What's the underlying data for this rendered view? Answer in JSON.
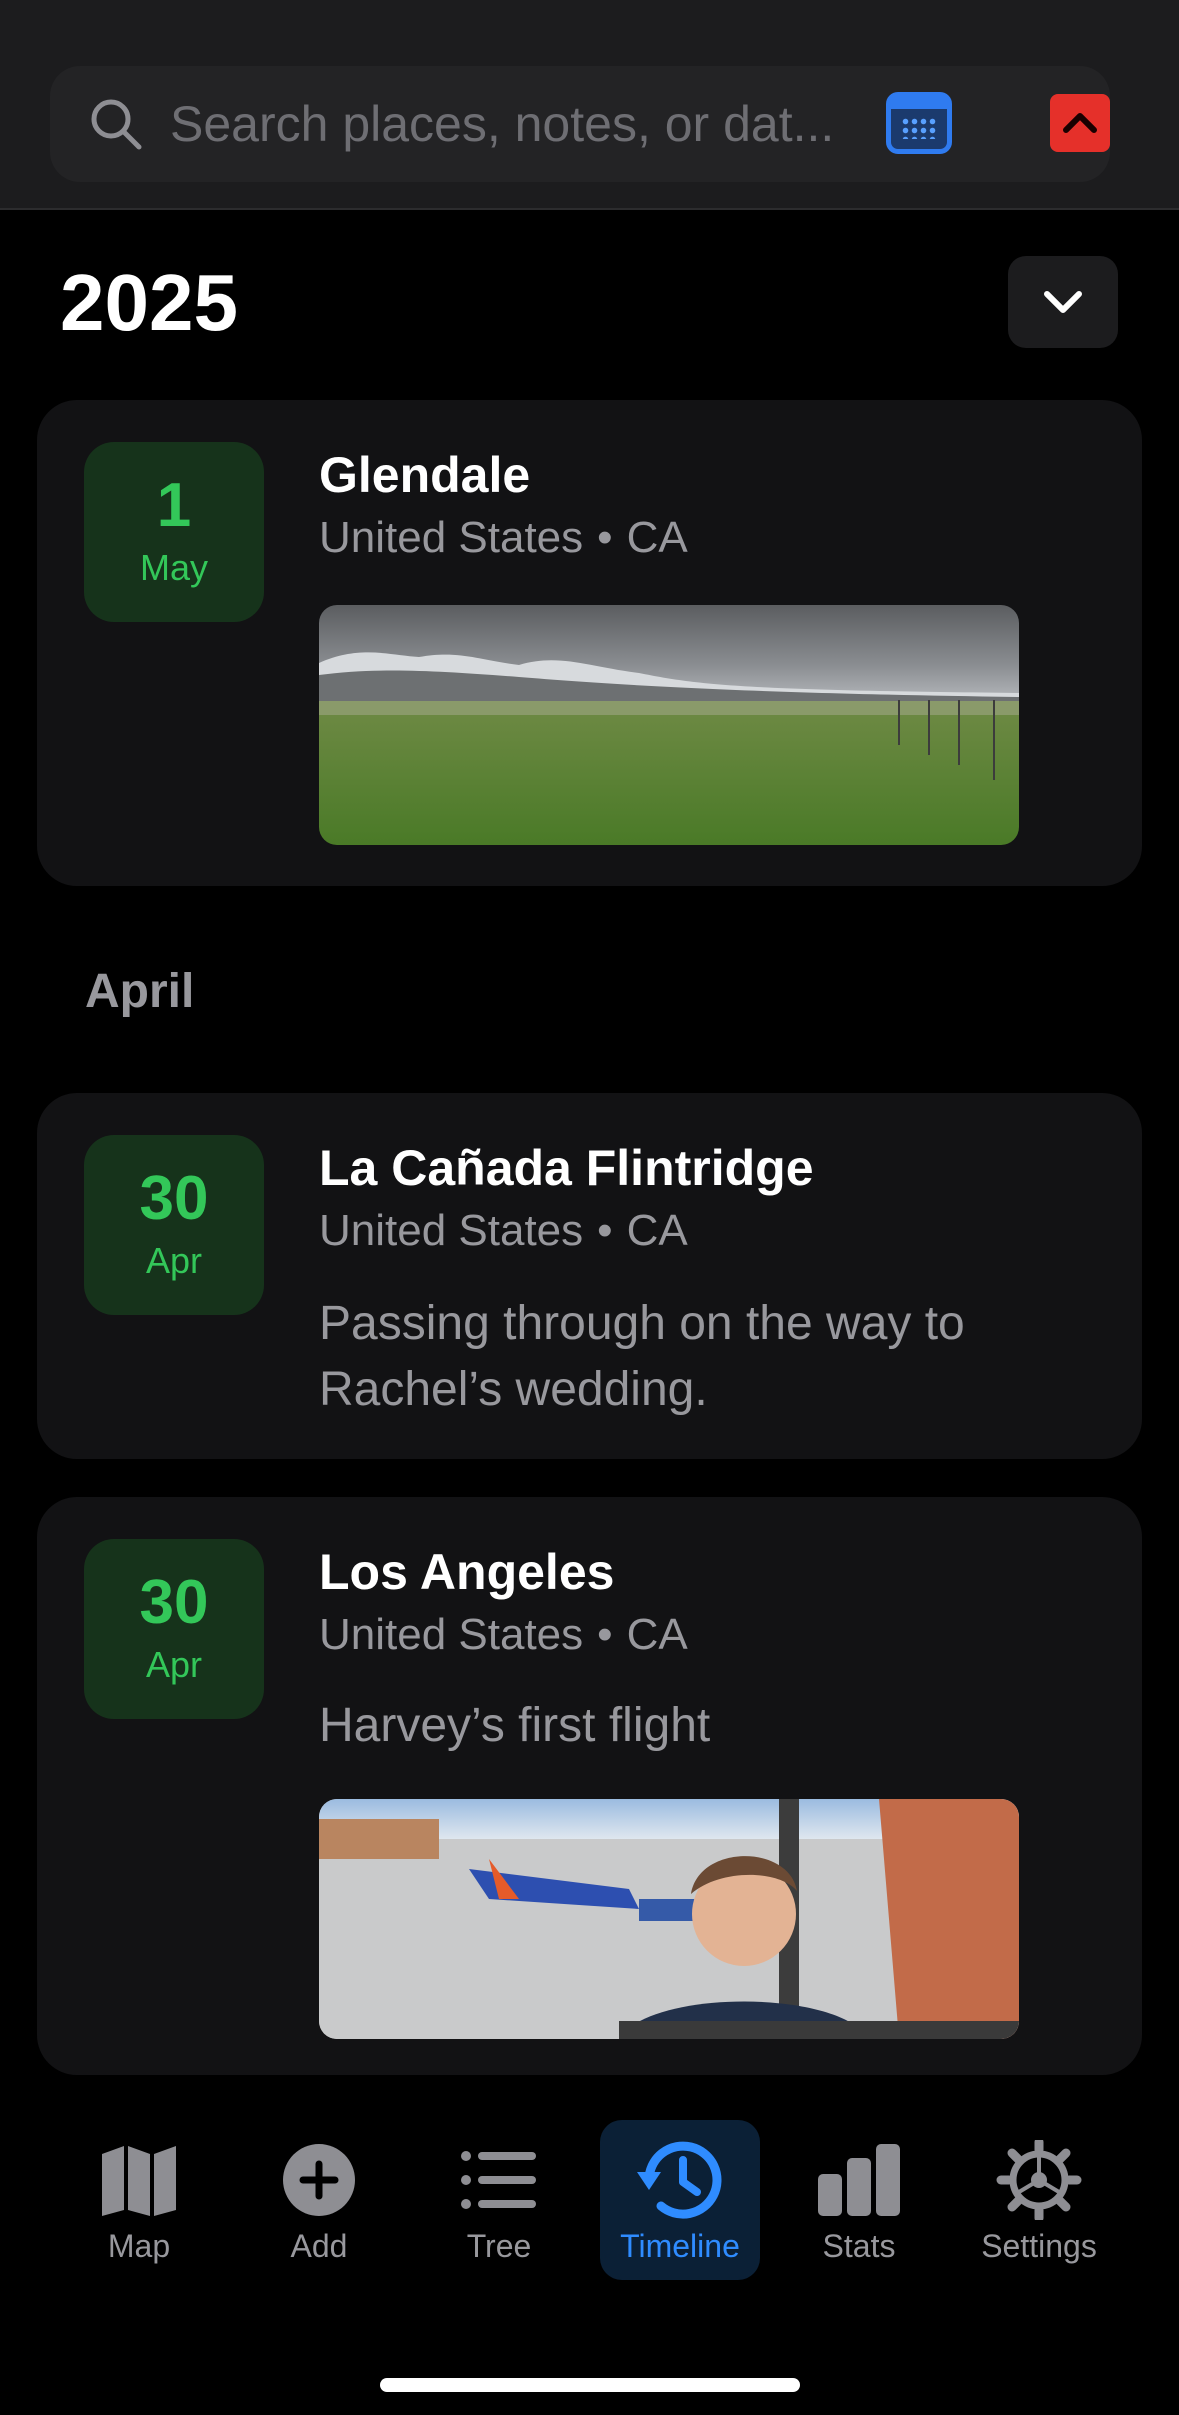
{
  "search": {
    "placeholder": "Search places, notes, or dat..."
  },
  "timeline": {
    "year": "2025",
    "entries_top": [
      {
        "day": "1",
        "month": "May",
        "place": "Glendale",
        "country": "United States",
        "separator": "•",
        "state": "CA"
      }
    ],
    "section_month": "April",
    "entries_april": [
      {
        "day": "30",
        "month": "Apr",
        "place": "La Cañada Flintridge",
        "country": "United States",
        "separator": "•",
        "state": "CA",
        "note": "Passing through on the way to Rachel’s wedding."
      },
      {
        "day": "30",
        "month": "Apr",
        "place": "Los Angeles",
        "country": "United States",
        "separator": "•",
        "state": "CA",
        "note": "Harvey’s first flight"
      }
    ]
  },
  "tabs": [
    {
      "label": "Map",
      "icon": "map-icon"
    },
    {
      "label": "Add",
      "icon": "add-circle-icon"
    },
    {
      "label": "Tree",
      "icon": "list-icon"
    },
    {
      "label": "Timeline",
      "icon": "history-clock-icon",
      "active": true
    },
    {
      "label": "Stats",
      "icon": "bar-chart-icon"
    },
    {
      "label": "Settings",
      "icon": "gear-icon"
    }
  ],
  "colors": {
    "accent": "#2f8cff",
    "badge_green": "#33c759",
    "badge_bg": "#16331b",
    "alert_red": "#e5302a"
  }
}
